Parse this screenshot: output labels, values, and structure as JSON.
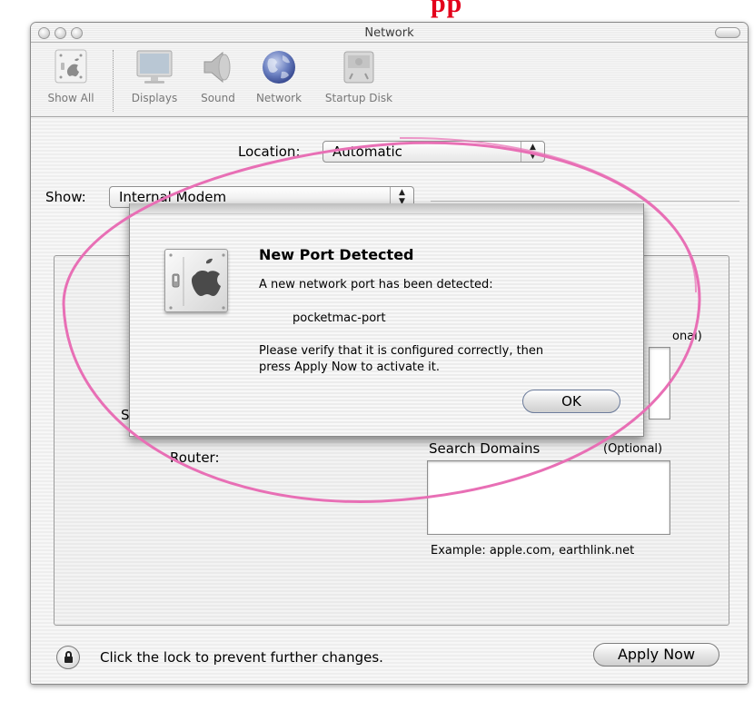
{
  "window": {
    "title": "Network"
  },
  "toolbar": {
    "items": [
      {
        "label": "Show All",
        "icon": "show-all-icon"
      },
      {
        "label": "Displays",
        "icon": "displays-icon"
      },
      {
        "label": "Sound",
        "icon": "sound-icon"
      },
      {
        "label": "Network",
        "icon": "network-globe-icon"
      },
      {
        "label": "Startup Disk",
        "icon": "startup-disk-icon"
      }
    ]
  },
  "location": {
    "label": "Location:",
    "value": "Automatic"
  },
  "show": {
    "label": "Show:",
    "value": "Internal Modem"
  },
  "panel": {
    "optional_top": "onal)",
    "router_label": "Router:",
    "search_domains_label": "Search Domains",
    "search_domains_optional": "(Optional)",
    "example_text": "Example: apple.com, earthlink.net",
    "partial_label_s": "S"
  },
  "dialog": {
    "title": "New Port Detected",
    "message": "A new network port has been detected:",
    "port_name": "pocketmac-port",
    "instructions_line1": "Please verify that it is configured correctly, then",
    "instructions_line2": "press Apply Now to activate it.",
    "ok_label": "OK"
  },
  "footer": {
    "lock_text": "Click the lock to prevent further changes.",
    "apply_label": "Apply Now"
  },
  "colors": {
    "annotation_ellipse": "#e86fb5",
    "top_fragment": "#e3001b"
  },
  "top_fragment": "pp"
}
